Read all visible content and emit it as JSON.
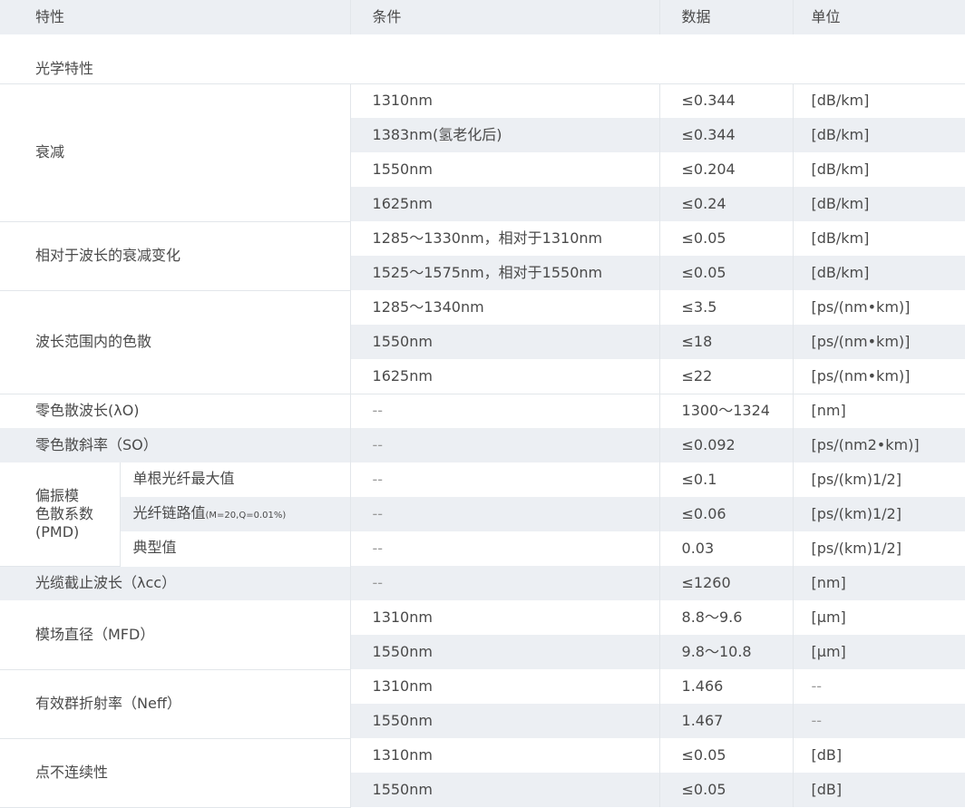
{
  "header": {
    "c0": "特性",
    "c1": "条件",
    "c2": "数据",
    "c3": "单位"
  },
  "section_title": "光学特性",
  "groups": {
    "attenuation": {
      "name": "衰减",
      "rows": [
        {
          "cond": "1310nm",
          "value": "≤0.344",
          "unit": "[dB/km]"
        },
        {
          "cond": "1383nm(氢老化后)",
          "value": "≤0.344",
          "unit": "[dB/km]"
        },
        {
          "cond": "1550nm",
          "value": "≤0.204",
          "unit": "[dB/km]"
        },
        {
          "cond": "1625nm",
          "value": "≤0.24",
          "unit": "[dB/km]"
        }
      ]
    },
    "atten_variation": {
      "name": "相对于波长的衰减变化",
      "rows": [
        {
          "cond": "1285～1330nm，相对于1310nm",
          "value": "≤0.05",
          "unit": "[dB/km]"
        },
        {
          "cond": "1525～1575nm，相对于1550nm",
          "value": "≤0.05",
          "unit": "[dB/km]"
        }
      ]
    },
    "dispersion": {
      "name": "波长范围内的色散",
      "rows": [
        {
          "cond": "1285～1340nm",
          "value": "≤3.5",
          "unit": "[ps/(nm•km)]"
        },
        {
          "cond": "1550nm",
          "value": "≤18",
          "unit": "[ps/(nm•km)]"
        },
        {
          "cond": "1625nm",
          "value": "≤22",
          "unit": "[ps/(nm•km)]"
        }
      ]
    },
    "zero_wavelength": {
      "name": "零色散波长(λO)",
      "cond": "--",
      "value": "1300～1324",
      "unit": "[nm]"
    },
    "zero_slope": {
      "name": "零色散斜率（SO）",
      "cond": "--",
      "value": "≤0.092",
      "unit": "[ps/(nm2•km)]"
    },
    "pmd": {
      "name_line1": "偏振模",
      "name_line2": "色散系数",
      "name_line3": "(PMD)",
      "rows": [
        {
          "sub": "单根光纤最大值",
          "sub_small": "",
          "cond": "--",
          "value": "≤0.1",
          "unit": "[ps/(km)1/2]"
        },
        {
          "sub": "光纤链路值",
          "sub_small": "(M=20,Q=0.01%)",
          "cond": "--",
          "value": "≤0.06",
          "unit": "[ps/(km)1/2]"
        },
        {
          "sub": "典型值",
          "sub_small": "",
          "cond": "--",
          "value": "0.03",
          "unit": "[ps/(km)1/2]"
        }
      ]
    },
    "cutoff": {
      "name": "光缆截止波长（λcc）",
      "cond": "--",
      "value": "≤1260",
      "unit": "[nm]"
    },
    "mfd": {
      "name": "模场直径（MFD）",
      "rows": [
        {
          "cond": "1310nm",
          "value": "8.8～9.6",
          "unit": "[µm]"
        },
        {
          "cond": "1550nm",
          "value": "9.8～10.8",
          "unit": "[µm]"
        }
      ]
    },
    "neff": {
      "name": "有效群折射率（Neff）",
      "rows": [
        {
          "cond": "1310nm",
          "value": "1.466",
          "unit": "--"
        },
        {
          "cond": "1550nm",
          "value": "1.467",
          "unit": "--"
        }
      ]
    },
    "discontinuity": {
      "name": "点不连续性",
      "rows": [
        {
          "cond": "1310nm",
          "value": "≤0.05",
          "unit": "[dB]"
        },
        {
          "cond": "1550nm",
          "value": "≤0.05",
          "unit": "[dB]"
        }
      ]
    }
  }
}
